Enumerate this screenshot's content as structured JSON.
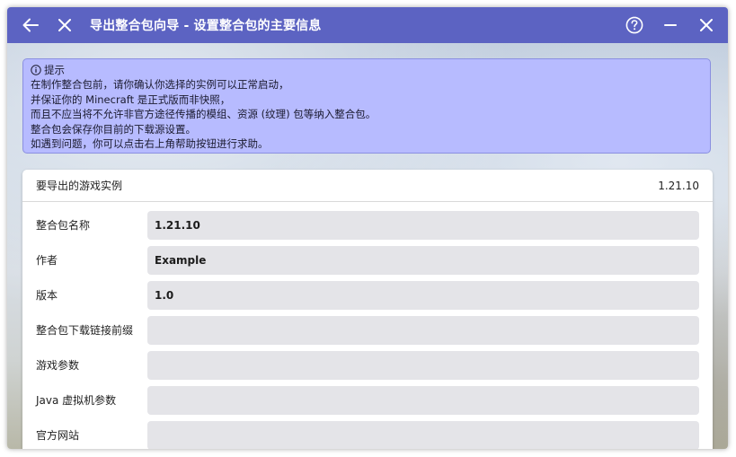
{
  "window": {
    "title": "导出整合包向导 - 设置整合包的主要信息",
    "accent": "#5c63c2"
  },
  "titlebar": {
    "back_icon": "arrow-left-icon",
    "close_icon": "close-icon",
    "help_icon": "help-circle-icon",
    "minimize_icon": "minimize-icon",
    "window_close_icon": "close-icon"
  },
  "notice": {
    "title": "提示",
    "icon": "info-circle-icon",
    "background": "#b7bbff",
    "lines": [
      "在制作整合包前，请你确认你选择的实例可以正常启动，",
      "并保证你的 Minecraft 是正式版而非快照，",
      "而且不应当将不允许非官方途径传播的模组、资源 (纹理) 包等纳入整合包。",
      "整合包会保存你目前的下载源设置。",
      "如遇到问题，你可以点击右上角帮助按钮进行求助。"
    ]
  },
  "instance": {
    "label": "要导出的游戏实例",
    "value": "1.21.10"
  },
  "fields": [
    {
      "label": "整合包名称",
      "value": "1.21.10"
    },
    {
      "label": "作者",
      "value": "Example"
    },
    {
      "label": "版本",
      "value": "1.0"
    },
    {
      "label": "整合包下载链接前缀",
      "value": ""
    },
    {
      "label": "游戏参数",
      "value": ""
    },
    {
      "label": "Java 虚拟机参数",
      "value": ""
    },
    {
      "label": "官方网站",
      "value": ""
    }
  ]
}
